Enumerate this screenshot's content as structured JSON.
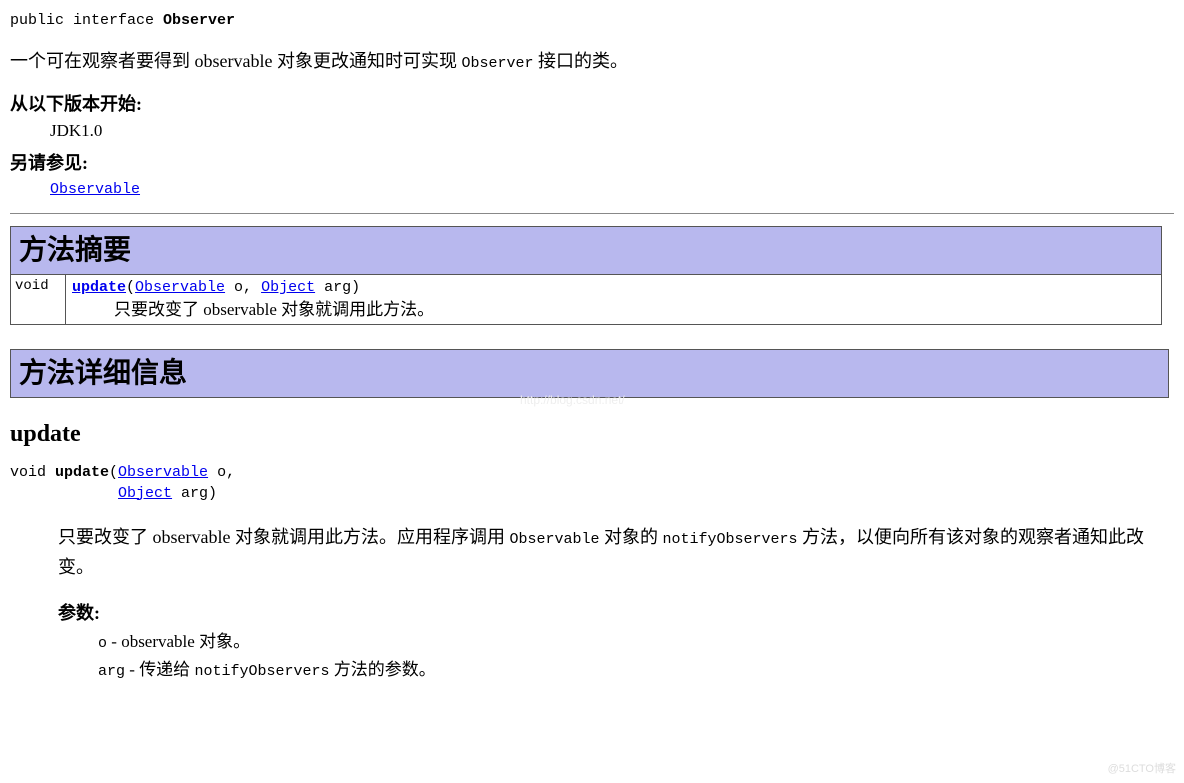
{
  "decl": {
    "prefix": "public interface ",
    "name": "Observer"
  },
  "intro": {
    "part1": "一个可在观察者要得到 observable 对象更改通知时可实现 ",
    "code": "Observer",
    "part2": " 接口的类。"
  },
  "meta": {
    "since_label": "从以下版本开始:",
    "since_value": "JDK1.0",
    "see_label": "另请参见:",
    "see_link": "Observable"
  },
  "summary": {
    "header": "方法摘要",
    "rows": [
      {
        "ret": " void",
        "method": "update",
        "sig_open": "(",
        "p1_type": "Observable",
        "p1_name": " o, ",
        "p2_type": "Object",
        "p2_name": " arg)",
        "desc": "只要改变了 observable 对象就调用此方法。"
      }
    ]
  },
  "detail": {
    "header": "方法详细信息",
    "method_heading": "update",
    "sig": {
      "prefix": "void ",
      "name": "update",
      "open": "(",
      "p1_type": "Observable",
      "p1_name": " o,",
      "p2_type": "Object",
      "p2_name": " arg)"
    },
    "desc": {
      "t1": "只要改变了 observable 对象就调用此方法。应用程序调用 ",
      "c1": "Observable",
      "t2": " 对象的 ",
      "c2": "notifyObservers",
      "t3": " 方法，以便向所有该对象的观察者通知此改变。"
    },
    "params_label": "参数:",
    "params": [
      {
        "name": "o",
        "sep": " - ",
        "text": "observable 对象。"
      },
      {
        "name": "arg",
        "sep": " - ",
        "text_pre": "传递给 ",
        "code": "notifyObservers",
        "text_post": " 方法的参数。"
      }
    ]
  },
  "watermark": "http://blog.csdn.net/",
  "footer": "@51CTO博客"
}
